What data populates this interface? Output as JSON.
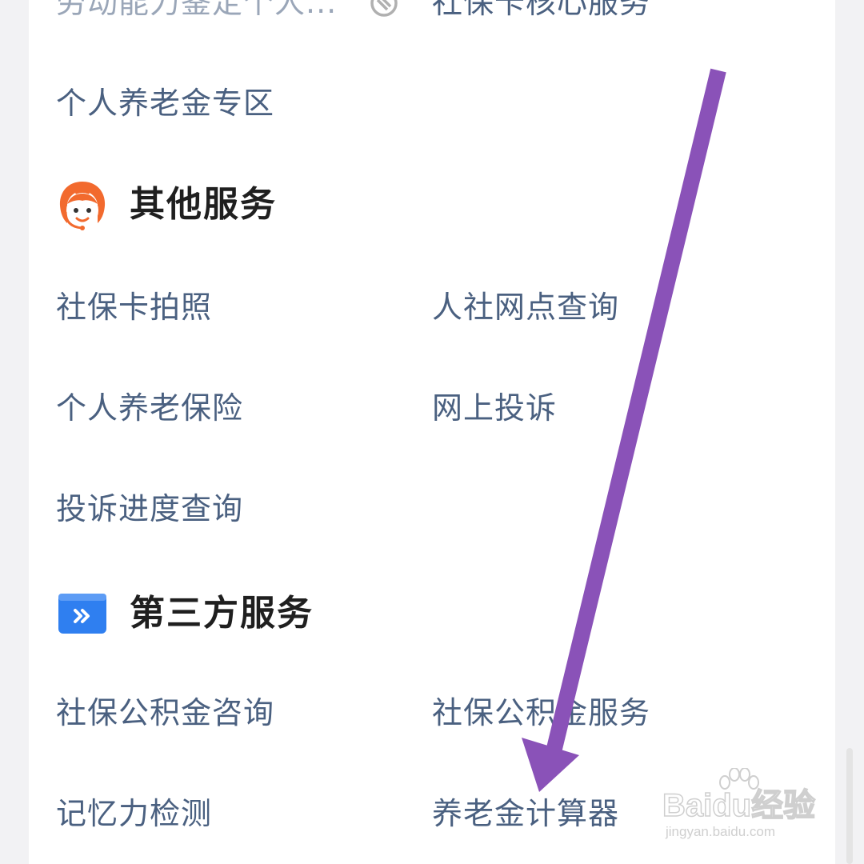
{
  "top_row": {
    "left_label": "劳动能力鉴定个人...",
    "right_label": "社保卡核心服务"
  },
  "pension_zone": {
    "label": "个人养老金专区"
  },
  "other_services": {
    "title": "其他服务",
    "items": [
      "社保卡拍照",
      "人社网点查询",
      "个人养老保险",
      "网上投诉",
      "投诉进度查询"
    ]
  },
  "third_party": {
    "title": "第三方服务",
    "items": [
      "社保公积金咨询",
      "社保公积金服务",
      "记忆力检测",
      "养老金计算器"
    ]
  },
  "watermark": {
    "logo": "Baidu经验",
    "url": "jingyan.baidu.com"
  },
  "colors": {
    "item_text": "#4a6080",
    "section_title": "#1f1f1f",
    "arrow": "#8a52b8",
    "other_services_icon": "#f26a2e",
    "third_party_icon": "#2f7ff0"
  }
}
